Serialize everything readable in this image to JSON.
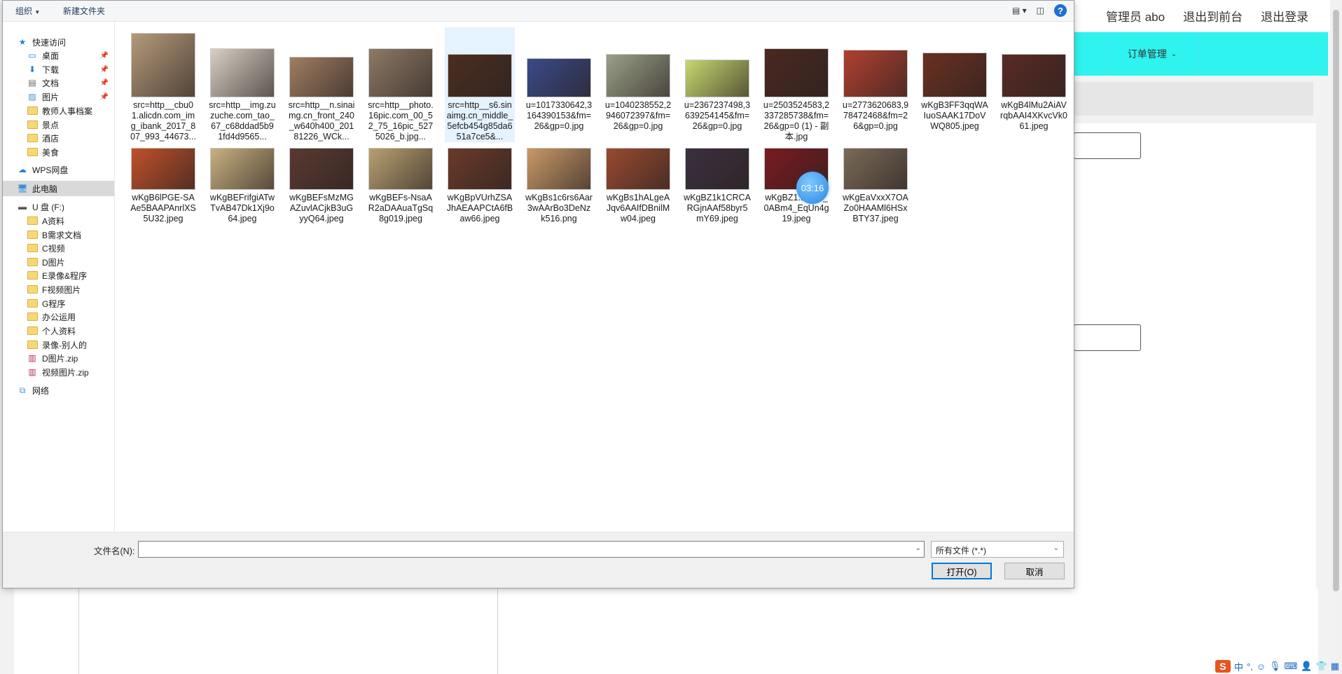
{
  "background_app": {
    "header": {
      "admin_user": "管理员 abo",
      "to_frontend": "退出到前台",
      "logout": "退出登录"
    },
    "nav": {
      "order_management": "订单管理"
    }
  },
  "dialog": {
    "toolbar": {
      "organize": "组织",
      "new_folder": "新建文件夹"
    },
    "nav_pane": {
      "items": [
        {
          "label": "快速访问",
          "icon": "star-icon"
        },
        {
          "label": "桌面",
          "icon": "desktop-icon",
          "pinned": true
        },
        {
          "label": "下载",
          "icon": "download-icon",
          "pinned": true
        },
        {
          "label": "文档",
          "icon": "document-icon",
          "pinned": true
        },
        {
          "label": "图片",
          "icon": "picture-icon",
          "pinned": true
        },
        {
          "label": "教师人事档案",
          "icon": "folder-icon"
        },
        {
          "label": "景点",
          "icon": "folder-icon"
        },
        {
          "label": "酒店",
          "icon": "folder-icon"
        },
        {
          "label": "美食",
          "icon": "folder-icon"
        },
        {
          "label": "WPS网盘",
          "icon": "cloud-icon"
        },
        {
          "label": "此电脑",
          "icon": "computer-icon",
          "selected": true
        },
        {
          "label": "U 盘 (F:)",
          "icon": "drive-icon"
        },
        {
          "label": "A资料",
          "icon": "folder-icon"
        },
        {
          "label": "B需求文档",
          "icon": "folder-icon"
        },
        {
          "label": "C视频",
          "icon": "folder-icon"
        },
        {
          "label": "D图片",
          "icon": "folder-icon"
        },
        {
          "label": "E录像&程序",
          "icon": "folder-icon"
        },
        {
          "label": "F视频图片",
          "icon": "folder-icon"
        },
        {
          "label": "G程序",
          "icon": "folder-icon"
        },
        {
          "label": "办公运用",
          "icon": "folder-icon"
        },
        {
          "label": "个人资料",
          "icon": "folder-icon"
        },
        {
          "label": "录像-别人的",
          "icon": "folder-icon"
        },
        {
          "label": "D图片.zip",
          "icon": "zip-icon"
        },
        {
          "label": "视频图片.zip",
          "icon": "zip-icon"
        },
        {
          "label": "网络",
          "icon": "network-icon"
        }
      ]
    },
    "files": [
      {
        "name": "src=http__cbu01.alicdn.com_img_ibank_2017_807_993_44673...",
        "color": "#b59a7a"
      },
      {
        "name": "src=http__img.zuzuche.com_tao_67_c68ddad5b91fd4d9565...",
        "color": "#d8d0c4"
      },
      {
        "name": "src=http__n.sinaimg.cn_front_240_w640h400_20181226_WCk...",
        "color": "#a07e62"
      },
      {
        "name": "src=http__photo.16pic.com_00_52_75_16pic_5275026_b.jpg...",
        "color": "#8e7a66"
      },
      {
        "name": "src=http__s6.sinaimg.cn_middle_5efcb454g85da651a7ce5&...",
        "color": "#4a2e20",
        "selected": true
      },
      {
        "name": "u=1017330642,3164390153&fm=26&gp=0.jpg",
        "color": "#3a4a8a"
      },
      {
        "name": "u=1040238552,2946072397&fm=26&gp=0.jpg",
        "color": "#9aa088"
      },
      {
        "name": "u=2367237498,3639254145&fm=26&gp=0.jpg",
        "color": "#c8d870"
      },
      {
        "name": "u=2503524583,2337285738&fm=26&gp=0 (1) - 副本.jpg",
        "color": "#4a2820"
      },
      {
        "name": "u=2773620683,978472468&fm=26&gp=0.jpg",
        "color": "#b04030"
      },
      {
        "name": "wKgB3FF3qqWAIuoSAAK17DoVWQ805.jpeg",
        "color": "#6a3020"
      },
      {
        "name": "wKgB4lMu2AiAVrqbAAI4XKvcVk061.jpeg",
        "color": "#5a2a24"
      },
      {
        "name": "wKgB6lPGE-SAAe5BAAPAnrlXS5U32.jpeg",
        "color": "#c0502a"
      },
      {
        "name": "wKgBEFrifgiATwTvAB47Dk1Xj9o64.jpeg",
        "color": "#c8b080"
      },
      {
        "name": "wKgBEFsMzMGAZuvlACjkB3uGyyQ64.jpeg",
        "color": "#5a3a30"
      },
      {
        "name": "wKgBEFs-NsaAR2aDAAuaTgSq8g019.jpeg",
        "color": "#b8a070"
      },
      {
        "name": "wKgBpVUrhZSAJhAEAAPCtA6fBaw66.jpeg",
        "color": "#6a3a2a"
      },
      {
        "name": "wKgBs1c6rs6Aar3wAArBo3DeNzk516.png",
        "color": "#c89868"
      },
      {
        "name": "wKgBs1hALgeAJqv6AAIfDBnilMw04.jpeg",
        "color": "#9a4a30"
      },
      {
        "name": "wKgBZ1k1CRCARGjnAAf58byr5mY69.jpeg",
        "color": "#3a3040"
      },
      {
        "name": "wKgBZ1...ANT_0ABm4_EqUn4g19.jpeg",
        "color": "#7a1a20"
      },
      {
        "name": "wKgEaVxxX7OAZo0HAAMl6HSxBTY37.jpeg",
        "color": "#7a6a58"
      }
    ],
    "timer": "03:16",
    "bottom": {
      "filename_label": "文件名(N):",
      "filename_value": "",
      "filetype": "所有文件 (*.*)",
      "open": "打开(O)",
      "cancel": "取消"
    }
  },
  "ime": {
    "label": "中",
    "punct": "°,"
  }
}
